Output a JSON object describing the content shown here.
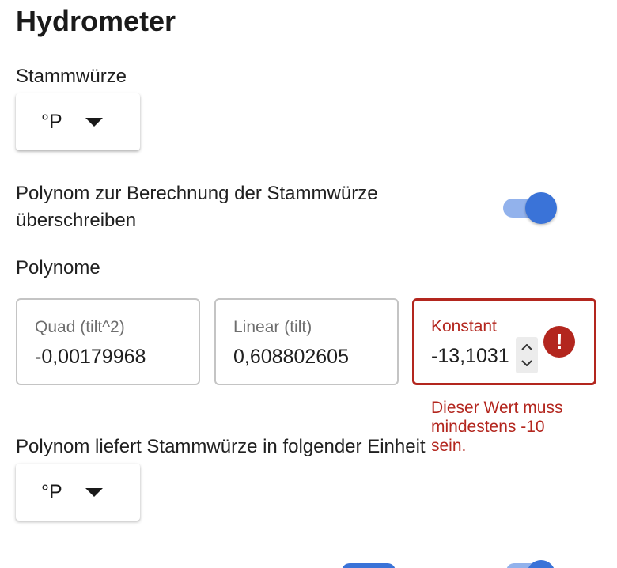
{
  "page": {
    "title": "Hydrometer"
  },
  "gravity_unit": {
    "label": "Stammwürze",
    "selected": "°P"
  },
  "override_polynomial": {
    "label": "Polynom zur Berechnung der Stammwürze überschreiben",
    "enabled": true
  },
  "polynomials": {
    "label": "Polynome",
    "fields": [
      {
        "label": "Quad (tilt^2)",
        "value": "-0,00179968"
      },
      {
        "label": "Linear (tilt)",
        "value": "0,608802605"
      },
      {
        "label": "Konstant",
        "value": "-13,1031",
        "error": "Dieser Wert muss mindestens -10 sein."
      }
    ]
  },
  "result_unit": {
    "label": "Polynom liefert Stammwürze in folgender Einheit",
    "selected": "°P"
  },
  "colors": {
    "accent": "#3a73d8",
    "accent_light": "#92b2ec",
    "error": "#b3261e",
    "border": "#c4c4c4"
  },
  "icons": {
    "dropdown": "caret-down-icon",
    "error": "error-exclamation-icon",
    "spinner_up": "chevron-up-icon",
    "spinner_down": "chevron-down-icon"
  }
}
